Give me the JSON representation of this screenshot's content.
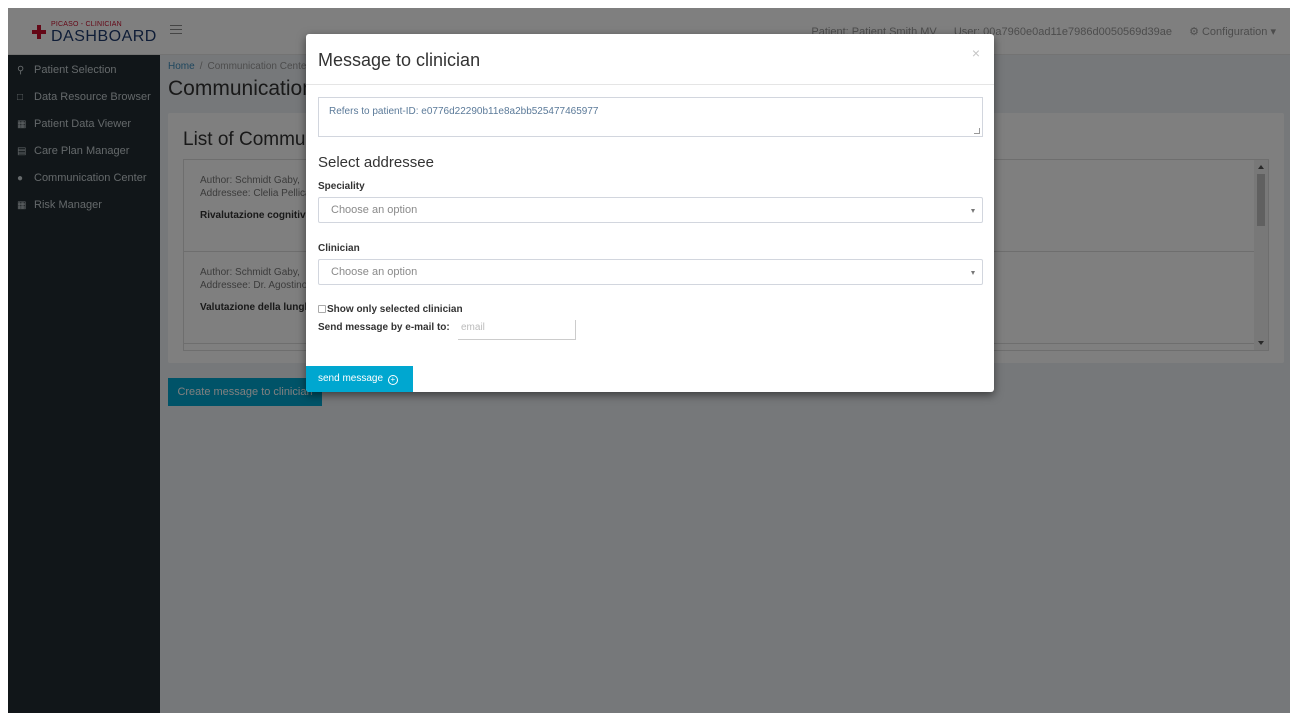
{
  "header": {
    "logo_small": "PICASO - CLINICIAN",
    "logo_big": "DASHBOARD",
    "patient": "Patient: Patient Smith MV",
    "user": "User: 00a7960e0ad11e7986d0050569d39ae",
    "configuration": "Configuration"
  },
  "sidebar": {
    "items": [
      {
        "label": "Patient Selection",
        "icon": "search-icon"
      },
      {
        "label": "Data Resource Browser",
        "icon": "folder-icon"
      },
      {
        "label": "Patient Data Viewer",
        "icon": "image-icon"
      },
      {
        "label": "Care Plan Manager",
        "icon": "table-icon"
      },
      {
        "label": "Communication Center",
        "icon": "comment-icon"
      },
      {
        "label": "Risk Manager",
        "icon": "calculator-icon"
      }
    ]
  },
  "breadcrumb": {
    "home": "Home",
    "current": "Communication Center"
  },
  "page": {
    "title": "Communication Center",
    "list_title": "List of Communications",
    "messages": [
      {
        "author": "Author: Schmidt Gaby,",
        "addressee": "Addressee: Clelia Pellicano",
        "subject": "Rivalutazione cognitiva"
      },
      {
        "author": "Author: Schmidt Gaby,",
        "addressee": "Addressee: Dr. Agostino",
        "subject": "Valutazione della lunghezza"
      }
    ],
    "create_button": "Create message to clinician"
  },
  "modal": {
    "title": "Message to clinician",
    "close": "×",
    "refers_to": "Refers to patient-ID: e0776d22290b11e8a2bb525477465977",
    "select_addressee": "Select addressee",
    "speciality_label": "Speciality",
    "speciality_value": "Choose an option",
    "clinician_label": "Clinician",
    "clinician_value": "Choose an option",
    "show_only_selected": "Show only selected clinician",
    "send_email_label": "Send message by e-mail to:",
    "email_placeholder": "email",
    "send_button": "send message"
  },
  "colors": {
    "sidebar_bg": "#222d32",
    "accent": "#00a7d0",
    "logo_red": "#c8102e",
    "logo_blue": "#1e3a6e",
    "link": "#3c8dbc"
  }
}
